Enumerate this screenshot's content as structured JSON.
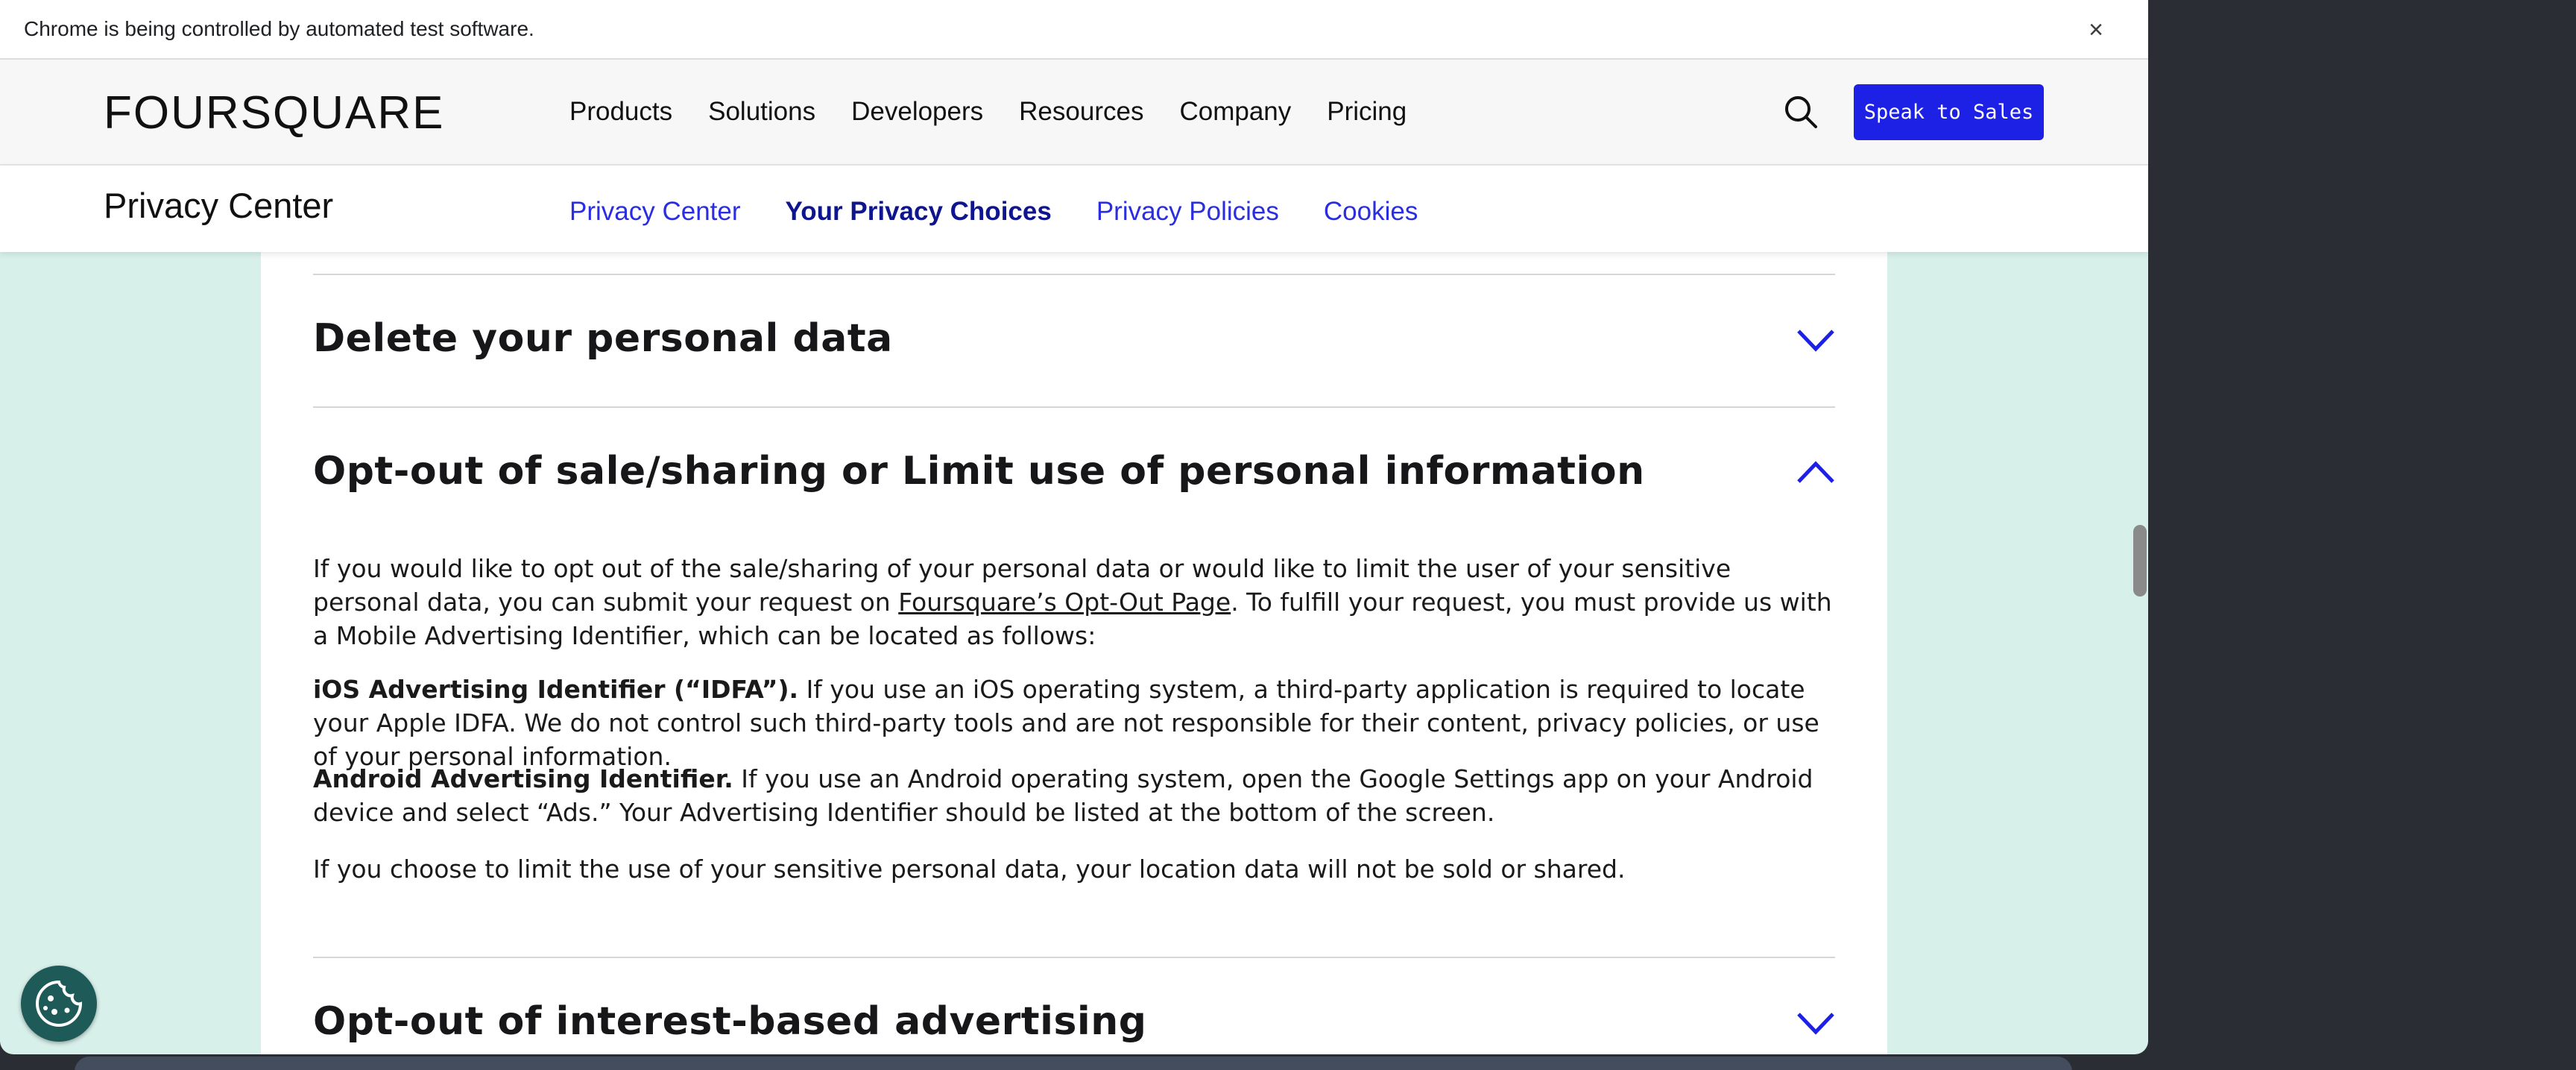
{
  "browser": {
    "infobar_text": "Chrome is being controlled by automated test software.",
    "close_symbol": "×"
  },
  "header": {
    "logo": "FOURSQUARE",
    "nav": [
      "Products",
      "Solutions",
      "Developers",
      "Resources",
      "Company",
      "Pricing"
    ],
    "search_icon": "search-icon",
    "cta": "Speak to Sales",
    "cta_color": "#1d21e6"
  },
  "subheader": {
    "title": "Privacy Center",
    "nav": [
      {
        "label": "Privacy Center",
        "active": false
      },
      {
        "label": "Your Privacy Choices",
        "active": true
      },
      {
        "label": "Privacy Policies",
        "active": false
      },
      {
        "label": "Cookies",
        "active": false
      }
    ],
    "link_color": "#2a2ee0",
    "active_color": "#0f158f"
  },
  "content": {
    "sections": [
      {
        "title": "Delete your personal data",
        "expanded": false
      },
      {
        "title": "Opt-out of sale/sharing or Limit use of personal information",
        "expanded": true
      },
      {
        "title": "Opt-out of interest-based advertising",
        "expanded": false
      }
    ],
    "optout": {
      "intro_before_link": "If you would like to opt out of the sale/sharing of your personal data or would like to limit the user of your sensitive personal data, you can submit your request on ",
      "intro_link": "Foursquare’s Opt-Out Page",
      "intro_after_link": ". To fulfill your request, you must provide us with a Mobile Advertising Identifier, which can be located as follows:",
      "ios_label": "iOS Advertising Identifier (“IDFA”).",
      "ios_text": " If you use an iOS operating system, a third-party application is required to locate your Apple IDFA. We do not control such third-party tools and are not responsible for their content, privacy policies, or use of your personal information.",
      "android_label": "Android Advertising Identifier.",
      "android_text": " If you use an Android operating system, open the Google Settings app on your Android device and select “Ads.” Your Advertising Identifier should be listed at the bottom of the screen.",
      "limit_text": "If you choose to limit the use of your sensitive personal data, your location data will not be sold or shared."
    }
  },
  "widgets": {
    "cookie_icon": "cookie-icon",
    "chevron_color": "#1d21e6"
  }
}
